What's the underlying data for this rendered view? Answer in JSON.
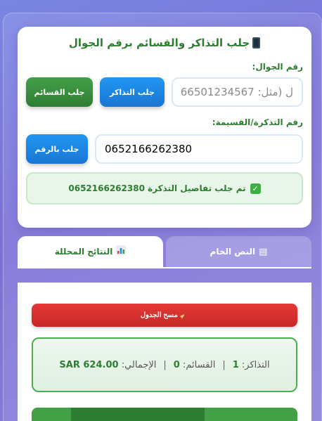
{
  "card": {
    "title": "جلب التذاكر والقسائم برقم الجوال",
    "phone_label": "رقم الجوال:",
    "phone_placeholder": "ل (مثل: 966501234567)",
    "fetch_tickets_label": "جلب التذاكر",
    "fetch_vouchers_label": "جلب القسائم",
    "ticket_label": "رقم التذكرة/القسيمة:",
    "ticket_value": "0652166262380",
    "fetch_by_number_label": "جلب بالرقم",
    "success_message": "تم جلب تفاصيل التذكرة 0652166262380"
  },
  "tabs": {
    "raw_text": "النص الخام",
    "analyzed_results": "النتائج المحللة"
  },
  "panel": {
    "clear_table_label": "مسح الجدول",
    "tickets_label": "التذاكر:",
    "tickets_count": "1",
    "vouchers_label": "القسائم:",
    "vouchers_count": "0",
    "total_label": "الإجمالي:",
    "total_value": "SAR 624.00",
    "separator": "|"
  },
  "colors": {
    "accent_green": "#2e7d32",
    "button_blue": "#1976d2",
    "danger_red": "#c62828"
  },
  "icons": {
    "title_icon": "mobile-phone-icon",
    "success_icon": "check-mark-icon",
    "raw_tab_icon": "document-icon",
    "analyzed_tab_icon": "bar-chart-icon",
    "clear_icon": "broom-icon"
  }
}
